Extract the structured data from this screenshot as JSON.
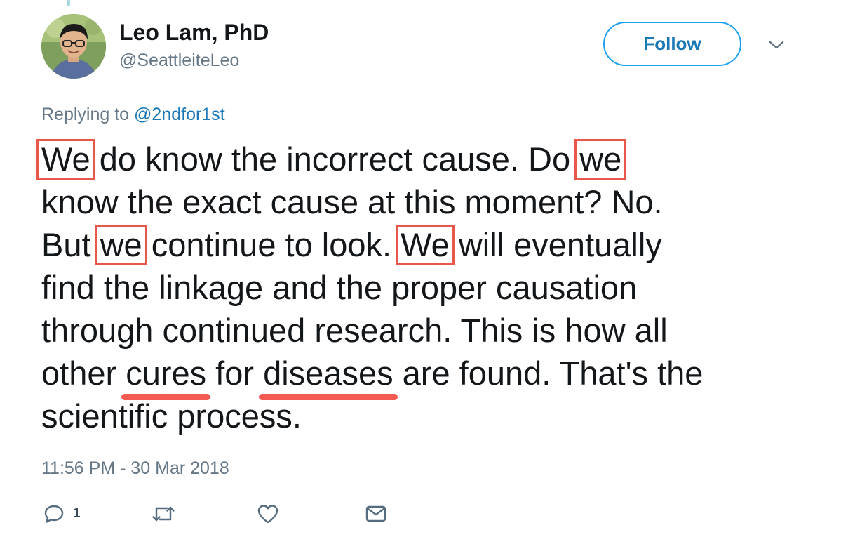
{
  "user": {
    "display_name": "Leo Lam, PhD",
    "handle": "@SeattleiteLeo",
    "avatar_icon": "profile-photo"
  },
  "follow_label": "Follow",
  "reply_to": {
    "prefix": "Replying to ",
    "mention": "@2ndfor1st"
  },
  "tweet": {
    "w1": "We",
    "t1": " do know the incorrect cause. Do ",
    "w2": "we",
    "t2": "know the exact cause at this moment? No.",
    "t3": "But ",
    "w3": "we",
    "t4": " continue to look. ",
    "w4": "We",
    "t5": " will eventually",
    "t6": "find the linkage and the proper causation",
    "t7": "through continued research. This is how all",
    "t8": "other ",
    "u1": "cures",
    "t9": " for ",
    "u2": "diseases",
    "t10": " are found. That's the",
    "t11": "scientific process."
  },
  "annotation_colors": {
    "box": "#e8574a",
    "underline": "#f25a52"
  },
  "timestamp": "11:56 PM - 30 Mar 2018",
  "actions": {
    "reply_icon": "reply-icon",
    "reply_count": "1",
    "retweet_icon": "retweet-icon",
    "like_icon": "heart-icon",
    "dm_icon": "envelope-icon"
  },
  "colors": {
    "link": "#1a77b5",
    "follow_border": "#1da1f2",
    "secondary_text": "#657786"
  }
}
